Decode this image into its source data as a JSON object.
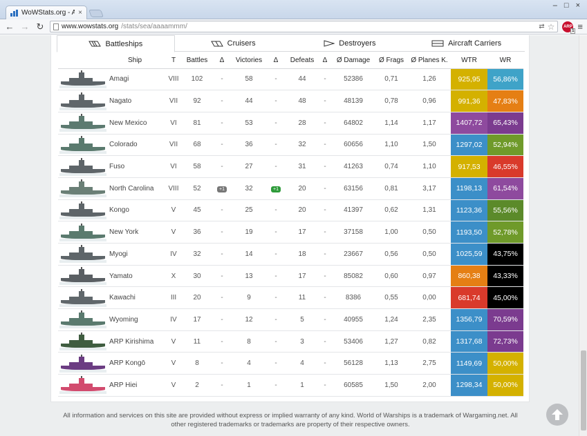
{
  "browser": {
    "tab_title": "WoWStats.org - AAAAM",
    "tab_close": "×",
    "url_host": "www.wowstats.org",
    "url_path": "/stats/sea/aaaammm/",
    "extension_label": "ARP",
    "extension_badge": "1",
    "window_minimize": "–",
    "window_maximize": "□",
    "window_close": "×"
  },
  "category_tabs": [
    {
      "label": "Battleships",
      "active": true
    },
    {
      "label": "Cruisers",
      "active": false
    },
    {
      "label": "Destroyers",
      "active": false
    },
    {
      "label": "Aircraft Carriers",
      "active": false
    }
  ],
  "table": {
    "headers": [
      "Ship",
      "T",
      "Battles",
      "Δ",
      "Victories",
      "Δ",
      "Defeats",
      "Δ",
      "Ø Damage",
      "Ø Frags",
      "Ø Planes K.",
      "WTR",
      "WR"
    ],
    "rows": [
      {
        "ship": "Amagi",
        "tier": "VIII",
        "battles": "102",
        "d_battles": "-",
        "victories": "58",
        "d_victories": "-",
        "defeats": "44",
        "d_defeats": "-",
        "damage": "52386",
        "frags": "0,71",
        "planes": "1,26",
        "wtr": "925,95",
        "wtr_color": "#d4b100",
        "wr": "56,86%",
        "wr_color": "#3fa3c8",
        "ship_color": "#5d6468"
      },
      {
        "ship": "Nagato",
        "tier": "VII",
        "battles": "92",
        "d_battles": "-",
        "victories": "44",
        "d_victories": "-",
        "defeats": "48",
        "d_defeats": "-",
        "damage": "48139",
        "frags": "0,78",
        "planes": "0,96",
        "wtr": "991,36",
        "wtr_color": "#d4b100",
        "wr": "47,83%",
        "wr_color": "#e57f14",
        "ship_color": "#5f666a"
      },
      {
        "ship": "New Mexico",
        "tier": "VI",
        "battles": "81",
        "d_battles": "-",
        "victories": "53",
        "d_victories": "-",
        "defeats": "28",
        "d_defeats": "-",
        "damage": "64802",
        "frags": "1,14",
        "planes": "1,17",
        "wtr": "1407,72",
        "wtr_color": "#8e4a9e",
        "wr": "65,43%",
        "wr_color": "#7b3b8f",
        "ship_color": "#5c7a70"
      },
      {
        "ship": "Colorado",
        "tier": "VII",
        "battles": "68",
        "d_battles": "-",
        "victories": "36",
        "d_victories": "-",
        "defeats": "32",
        "d_defeats": "-",
        "damage": "60656",
        "frags": "1,10",
        "planes": "1,50",
        "wtr": "1297,02",
        "wtr_color": "#3c8fc8",
        "wr": "52,94%",
        "wr_color": "#6f9a2a",
        "ship_color": "#5a7a6e"
      },
      {
        "ship": "Fuso",
        "tier": "VI",
        "battles": "58",
        "d_battles": "-",
        "victories": "27",
        "d_victories": "-",
        "defeats": "31",
        "d_defeats": "-",
        "damage": "41263",
        "frags": "0,74",
        "planes": "1,10",
        "wtr": "917,53",
        "wtr_color": "#d4b100",
        "wr": "46,55%",
        "wr_color": "#d93a2b",
        "ship_color": "#5e6569"
      },
      {
        "ship": "North Carolina",
        "tier": "VIII",
        "battles": "52",
        "d_battles": "+1",
        "victories": "32",
        "d_victories": "+1",
        "defeats": "20",
        "d_defeats": "-",
        "damage": "63156",
        "frags": "0,81",
        "planes": "3,17",
        "wtr": "1198,13",
        "wtr_color": "#3c8fc8",
        "wr": "61,54%",
        "wr_color": "#8e4a9e",
        "ship_color": "#6a7f76"
      },
      {
        "ship": "Kongo",
        "tier": "V",
        "battles": "45",
        "d_battles": "-",
        "victories": "25",
        "d_victories": "-",
        "defeats": "20",
        "d_defeats": "-",
        "damage": "41397",
        "frags": "0,62",
        "planes": "1,31",
        "wtr": "1123,36",
        "wtr_color": "#3c8fc8",
        "wr": "55,56%",
        "wr_color": "#5b8a2a",
        "ship_color": "#5e6569"
      },
      {
        "ship": "New York",
        "tier": "V",
        "battles": "36",
        "d_battles": "-",
        "victories": "19",
        "d_victories": "-",
        "defeats": "17",
        "d_defeats": "-",
        "damage": "37158",
        "frags": "1,00",
        "planes": "0,50",
        "wtr": "1193,50",
        "wtr_color": "#3c8fc8",
        "wr": "52,78%",
        "wr_color": "#6f9a2a",
        "ship_color": "#5a7a6e"
      },
      {
        "ship": "Myogi",
        "tier": "IV",
        "battles": "32",
        "d_battles": "-",
        "victories": "14",
        "d_victories": "-",
        "defeats": "18",
        "d_defeats": "-",
        "damage": "23667",
        "frags": "0,56",
        "planes": "0,50",
        "wtr": "1025,59",
        "wtr_color": "#3c8fc8",
        "wr": "43,75%",
        "wr_color": "#000000",
        "ship_color": "#5e6569"
      },
      {
        "ship": "Yamato",
        "tier": "X",
        "battles": "30",
        "d_battles": "-",
        "victories": "13",
        "d_victories": "-",
        "defeats": "17",
        "d_defeats": "-",
        "damage": "85082",
        "frags": "0,60",
        "planes": "0,97",
        "wtr": "860,38",
        "wtr_color": "#e57f14",
        "wr": "43,33%",
        "wr_color": "#000000",
        "ship_color": "#5a5f63"
      },
      {
        "ship": "Kawachi",
        "tier": "III",
        "battles": "20",
        "d_battles": "-",
        "victories": "9",
        "d_victories": "-",
        "defeats": "11",
        "d_defeats": "-",
        "damage": "8386",
        "frags": "0,55",
        "planes": "0,00",
        "wtr": "681,74",
        "wtr_color": "#d93a2b",
        "wr": "45,00%",
        "wr_color": "#000000",
        "ship_color": "#60676b"
      },
      {
        "ship": "Wyoming",
        "tier": "IV",
        "battles": "17",
        "d_battles": "-",
        "victories": "12",
        "d_victories": "-",
        "defeats": "5",
        "d_defeats": "-",
        "damage": "40955",
        "frags": "1,24",
        "planes": "2,35",
        "wtr": "1356,79",
        "wtr_color": "#3c8fc8",
        "wr": "70,59%",
        "wr_color": "#7b3b8f",
        "ship_color": "#5a7a6e"
      },
      {
        "ship": "ARP Kirishima",
        "tier": "V",
        "battles": "11",
        "d_battles": "-",
        "victories": "8",
        "d_victories": "-",
        "defeats": "3",
        "d_defeats": "-",
        "damage": "53406",
        "frags": "1,27",
        "planes": "0,82",
        "wtr": "1317,68",
        "wtr_color": "#3c8fc8",
        "wr": "72,73%",
        "wr_color": "#7b3b8f",
        "ship_color": "#3f5d40"
      },
      {
        "ship": "ARP Kongō",
        "tier": "V",
        "battles": "8",
        "d_battles": "-",
        "victories": "4",
        "d_victories": "-",
        "defeats": "4",
        "d_defeats": "-",
        "damage": "56128",
        "frags": "1,13",
        "planes": "2,75",
        "wtr": "1149,69",
        "wtr_color": "#3c8fc8",
        "wr": "50,00%",
        "wr_color": "#d4b100",
        "ship_color": "#6b3c82"
      },
      {
        "ship": "ARP Hiei",
        "tier": "V",
        "battles": "2",
        "d_battles": "-",
        "victories": "1",
        "d_victories": "-",
        "defeats": "1",
        "d_defeats": "-",
        "damage": "60585",
        "frags": "1,50",
        "planes": "2,00",
        "wtr": "1298,34",
        "wtr_color": "#3c8fc8",
        "wr": "50,00%",
        "wr_color": "#d4b100",
        "ship_color": "#d24b6e"
      }
    ]
  },
  "footer": {
    "text": "All information and services on this site are provided without express or implied warranty of any kind. World of Warships is a trademark of Wargaming.net. All other registered trademarks or trademarks are property of their respective owners."
  },
  "colors": {
    "badge_battles": "#777777",
    "badge_victories": "#2e9b3a"
  }
}
